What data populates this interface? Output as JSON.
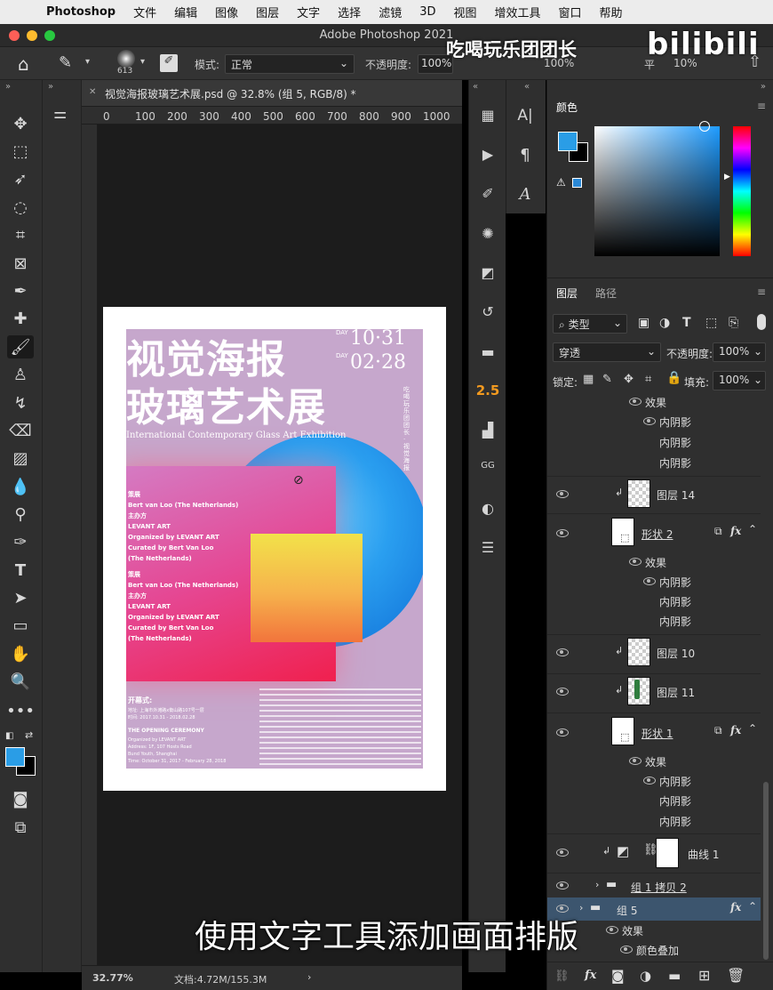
{
  "menubar": {
    "app": "Photoshop",
    "items": [
      "文件",
      "编辑",
      "图像",
      "图层",
      "文字",
      "选择",
      "滤镜",
      "3D",
      "视图",
      "增效工具",
      "窗口",
      "帮助"
    ]
  },
  "window": {
    "title": "Adobe Photoshop 2021"
  },
  "options": {
    "brush_size": "613",
    "mode_label": "模式:",
    "mode_value": "正常",
    "opacity_label": "不透明度:",
    "opacity_value": "100%",
    "flow_value": "100%",
    "smoothing_label": "平",
    "smoothing_value": "10%"
  },
  "document": {
    "tab_title": "视觉海报玻璃艺术展.psd @ 32.8% (组 5, RGB/8) *",
    "ruler_ticks": [
      "0",
      "100",
      "200",
      "300",
      "400",
      "500",
      "600",
      "700",
      "800",
      "900",
      "1000"
    ],
    "zoom": "32.77%",
    "doc_info": "文档:4.72M/155.3M"
  },
  "poster": {
    "title_line1": "视觉海报",
    "title_line2": "玻璃艺术展",
    "date1": "10·31",
    "date2": "02·28",
    "day_label": "DAY",
    "subtitle_en": "International Contemporary Glass Art Exhibition",
    "vertical_text": "吃喝玩乐团团长 · 视觉海报",
    "card_lines": [
      "策展",
      "Bert van Loo (The Netherlands)",
      "主办方",
      "LEVANT ART",
      "Organized by LEVANT ART",
      "Curated by Bert Van Loo",
      "(The Netherlands)",
      "策展",
      "Bert van Loo (The Netherlands)",
      "主办方",
      "LEVANT ART",
      "Organized by LEVANT ART",
      "Curated by Bert Van Loo",
      "(The Netherlands)"
    ],
    "opening_title": "开幕式:",
    "opening_lines": [
      "地址: 上海市外滩路x衡山路107号一层",
      "时间: 2017.10.31 - 2018.02.28"
    ],
    "ceremony_title": "THE OPENING CEREMONY",
    "ceremony_lines": [
      "Organized by LEVANT ART",
      "Address: 1F, 107 Hosts Road",
      "Bund Youth, Shanghai",
      "Time: October 31, 2017 - February 28, 2018"
    ]
  },
  "color_panel": {
    "tab": "颜色",
    "fg_color": "#2a9de6",
    "bg_color": "#000000"
  },
  "layers_panel": {
    "tab_layers": "图层",
    "tab_paths": "路径",
    "filter_label": "类型",
    "blend_mode": "穿透",
    "opacity_label": "不透明度:",
    "opacity_value": "100%",
    "lock_label": "锁定:",
    "fill_label": "填充:",
    "fill_value": "100%",
    "rows": [
      {
        "name": "效果"
      },
      {
        "name": "内阴影"
      },
      {
        "name": "内阴影"
      },
      {
        "name": "内阴影"
      },
      {
        "name": "图层 14"
      },
      {
        "name": "形状 2"
      },
      {
        "name": "效果"
      },
      {
        "name": "内阴影"
      },
      {
        "name": "内阴影"
      },
      {
        "name": "内阴影"
      },
      {
        "name": "图层 10"
      },
      {
        "name": "图层 11"
      },
      {
        "name": "形状 1"
      },
      {
        "name": "效果"
      },
      {
        "name": "内阴影"
      },
      {
        "name": "内阴影"
      },
      {
        "name": "内阴影"
      },
      {
        "name": "曲线 1"
      },
      {
        "name": "组 1 拷贝 2"
      },
      {
        "name": "组 5"
      },
      {
        "name": "效果"
      },
      {
        "name": "颜色叠加"
      }
    ]
  },
  "overlay": {
    "watermark": "吃喝玩乐团团长",
    "logo": "bilibili",
    "subtitle": "使用文字工具添加画面排版"
  }
}
